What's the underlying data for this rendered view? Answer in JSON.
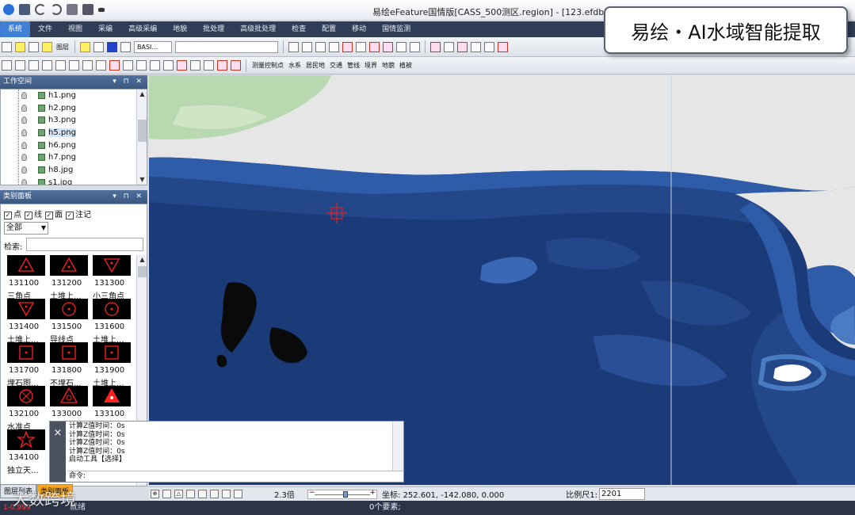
{
  "window": {
    "title": "易绘eFeature国情版[CASS_500测区.region] - [123.efdb]"
  },
  "menu": [
    "系统",
    "文件",
    "视图",
    "采编",
    "高级采编",
    "地貌",
    "批处理",
    "高级批处理",
    "检查",
    "配置",
    "移动",
    "国情监测"
  ],
  "toolbar": {
    "layer_label": "图层",
    "layer_combo": "BASI...",
    "category_buttons": [
      "测量控制点",
      "水系",
      "居民地",
      "交通",
      "管线",
      "境界",
      "地貌",
      "植被"
    ]
  },
  "banner": {
    "text": "易绘・AI水域智能提取"
  },
  "workspace": {
    "title": "工作空间",
    "files": [
      "h1.png",
      "h2.png",
      "h3.png",
      "h5.png",
      "h6.png",
      "h7.png",
      "h8.jpg",
      "s1.jpg"
    ],
    "selected": "h5.png"
  },
  "category_panel": {
    "title": "类别面板",
    "filters": [
      {
        "label": "点",
        "checked": true
      },
      {
        "label": "线",
        "checked": true
      },
      {
        "label": "面",
        "checked": true
      },
      {
        "label": "注记",
        "checked": true
      }
    ],
    "scope": "全部",
    "search_label": "检索:",
    "search_value": "",
    "symbols": [
      {
        "code": "131100",
        "name": "三角点",
        "shape": "triangle-dot"
      },
      {
        "code": "131200",
        "name": "土堆上...",
        "shape": "triangle-dot"
      },
      {
        "code": "131300",
        "name": "小三角点",
        "shape": "triangle-down"
      },
      {
        "code": "131400",
        "name": "土堆上...",
        "shape": "triangle-down"
      },
      {
        "code": "131500",
        "name": "导线点",
        "shape": "circle-dot"
      },
      {
        "code": "131600",
        "name": "土堆上...",
        "shape": "circle-dot"
      },
      {
        "code": "131700",
        "name": "埋石图...",
        "shape": "square-dot"
      },
      {
        "code": "131800",
        "name": "不埋石...",
        "shape": "square-dot"
      },
      {
        "code": "131900",
        "name": "土堆上...",
        "shape": "square-dot"
      },
      {
        "code": "132100",
        "name": "水准点",
        "shape": "circle-x"
      },
      {
        "code": "133000",
        "name": "",
        "shape": "triangle-circle"
      },
      {
        "code": "133100",
        "name": "",
        "shape": "triangle-filled"
      },
      {
        "code": "134100",
        "name": "独立天...",
        "shape": "star"
      }
    ]
  },
  "command": {
    "log": [
      "计算Z值时间：0s",
      "计算Z值时间：0s",
      "计算Z值时间：0s",
      "计算Z值时间：0s",
      "启动工具【选择】"
    ],
    "prompt": "命令:",
    "close_label": "×"
  },
  "panel_tabs": [
    "图层列表",
    "类别面板"
  ],
  "status": {
    "zoom": "2.3倍",
    "coords_label": "坐标:",
    "coords": "252.601,  -142.080,  0.000",
    "scale_label": "比例尺1:",
    "scale": "2201",
    "element_count": "0个要素;",
    "left_red": "1-0.999",
    "left_mid": "就绪"
  },
  "watermark": "大数跨境",
  "colors": {
    "menu_bg": "#2f3d56",
    "panel_header": "#3b5880",
    "water_deep": "#1b3a78",
    "water_mid": "#24478a",
    "water_shallow": "#2f5ca8",
    "land": "#e6e6e6",
    "vegetation": "#b8d9b0",
    "symbol_red": "#ff2020"
  }
}
